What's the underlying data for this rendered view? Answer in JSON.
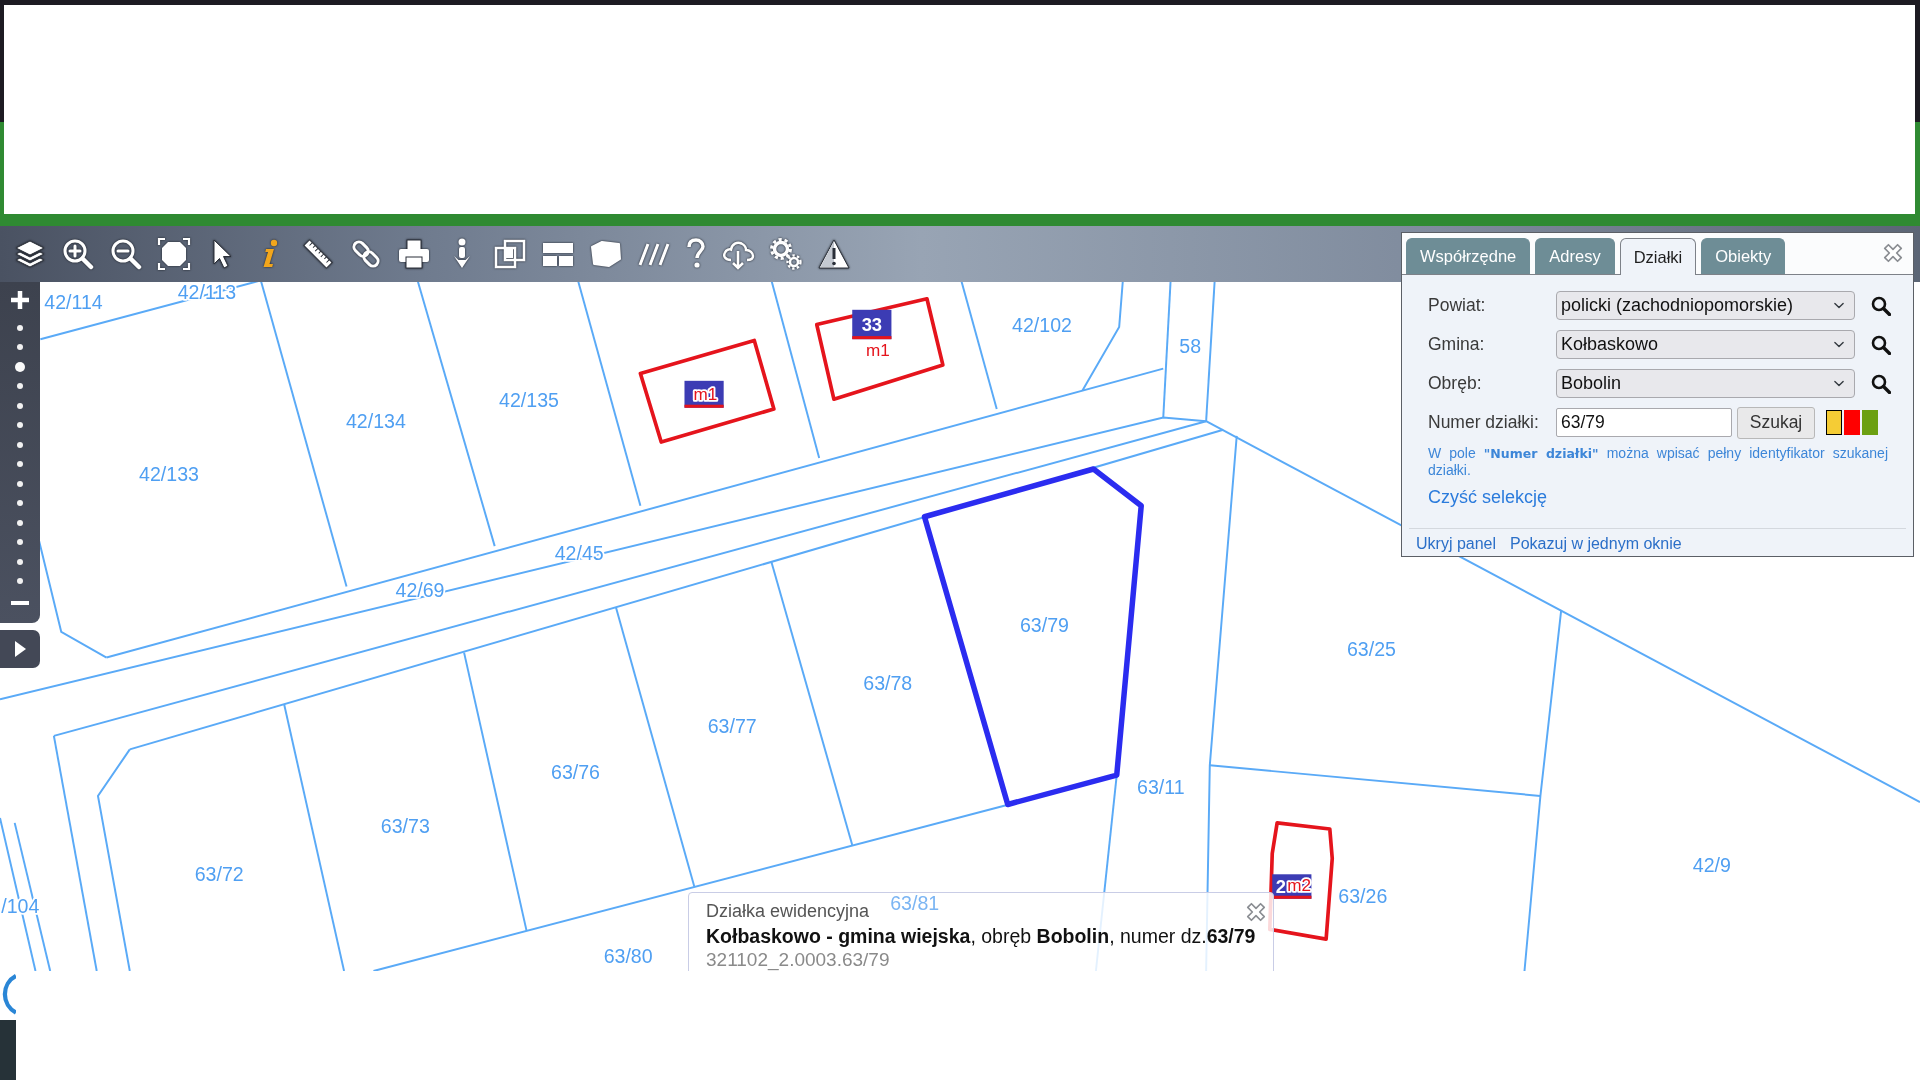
{
  "zoom_slider": {
    "level": 0.85
  },
  "map": {
    "parcel_labels": [
      "42/114",
      "42/113",
      "42/134",
      "42/135",
      "42/133",
      "42/102",
      "58",
      "42/69",
      "42/45",
      "63/79",
      "63/78",
      "63/77",
      "63/76",
      "63/73",
      "63/72",
      "/104",
      "63/81",
      "63/80",
      "63/11",
      "63/25",
      "63/26",
      "42/9"
    ],
    "buildings": [
      {
        "label": "m1"
      },
      {
        "number": "33",
        "label": "m1"
      },
      {
        "number": "2",
        "label": "m2"
      }
    ]
  },
  "search_panel": {
    "tabs": [
      {
        "label": "Współrzędne",
        "selected": false
      },
      {
        "label": "Adresy",
        "selected": false
      },
      {
        "label": "Działki",
        "selected": true
      },
      {
        "label": "Obiekty",
        "selected": false
      }
    ],
    "fields": [
      {
        "label": "Powiat:",
        "kind": "select",
        "value": "policki (zachodniopomorskie)"
      },
      {
        "label": "Gmina:",
        "kind": "select",
        "value": "Kołbaskowo"
      },
      {
        "label": "Obręb:",
        "kind": "select",
        "value": "Bobolin"
      },
      {
        "label": "Numer działki:",
        "kind": "text",
        "value": "63/79"
      }
    ],
    "search_button": "Szukaj",
    "highlight_colors": [
      {
        "color": "#f5cc35",
        "selected": true
      },
      {
        "color": "#ff0000",
        "selected": false
      },
      {
        "color": "#6ca012",
        "selected": false
      }
    ],
    "hint": "W pole **\"Numer działki\"** można wpisać pełny identyfikator szukanej działki.",
    "clear_link": "Czyść selekcję",
    "footer_links": [
      "Ukryj panel",
      "Pokazuj w jednym oknie"
    ]
  },
  "info_popup": {
    "title": "Działka ewidencyjna",
    "description": "**Kołbaskowo - gmina wiejska**, obręb **Bobolin**, numer dz.**63/79**",
    "identifier": "321102_2.0003.63/79"
  }
}
